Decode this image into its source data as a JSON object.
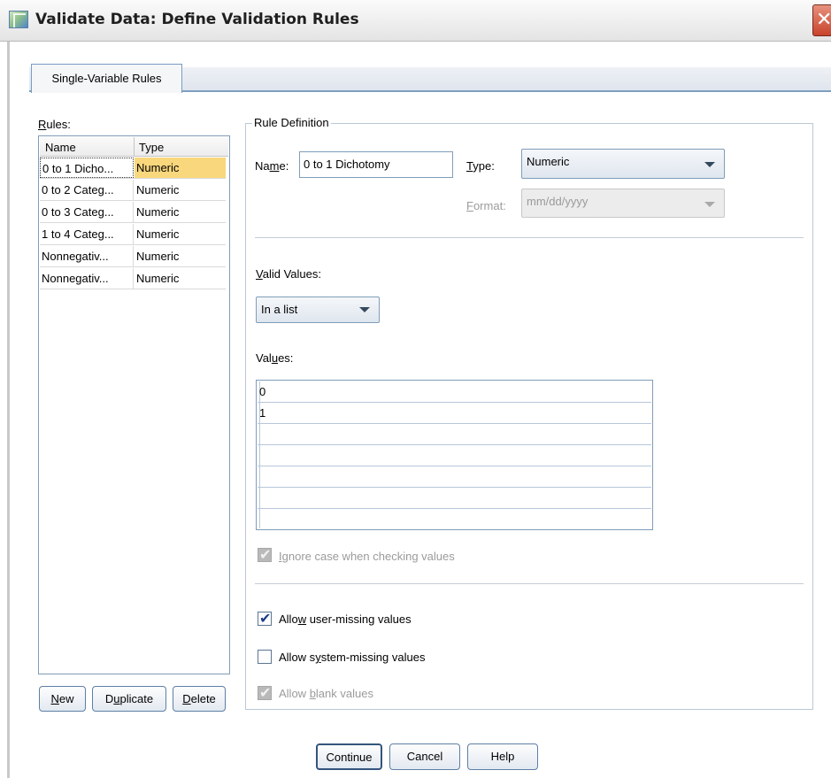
{
  "window": {
    "title": "Validate Data: Define Validation Rules",
    "close_symbol": "✕"
  },
  "tabs": [
    {
      "label": "Single-Variable Rules",
      "active": true
    }
  ],
  "rules": {
    "label": "Rules:",
    "columns": [
      "Name",
      "Type"
    ],
    "rows": [
      {
        "name": "0 to 1 Dicho...",
        "type": "Numeric",
        "selected": true
      },
      {
        "name": "0 to 2 Categ...",
        "type": "Numeric"
      },
      {
        "name": "0 to 3 Categ...",
        "type": "Numeric"
      },
      {
        "name": "1 to 4 Categ...",
        "type": "Numeric"
      },
      {
        "name": "Nonnegativ...",
        "type": "Numeric"
      },
      {
        "name": "Nonnegativ...",
        "type": "Numeric"
      }
    ],
    "buttons": {
      "new": "New",
      "duplicate": "Duplicate",
      "delete": "Delete"
    }
  },
  "definition": {
    "group_title": "Rule Definition",
    "name_label": "Name:",
    "name_value": "0 to 1 Dichotomy",
    "type_label": "Type:",
    "type_value": "Numeric",
    "format_label": "Format:",
    "format_value": "mm/dd/yyyy",
    "valid_values_label": "Valid Values:",
    "valid_values_value": "In a list",
    "values_label": "Values:",
    "values": [
      "0",
      "1",
      "",
      "",
      "",
      "",
      ""
    ],
    "ignore_case_label": "Ignore case when checking values",
    "allow_user_missing_label": "Allow user-missing values",
    "allow_system_missing_label": "Allow system-missing values",
    "allow_blank_label": "Allow blank values"
  },
  "footer": {
    "continue": "Continue",
    "cancel": "Cancel",
    "help": "Help"
  }
}
